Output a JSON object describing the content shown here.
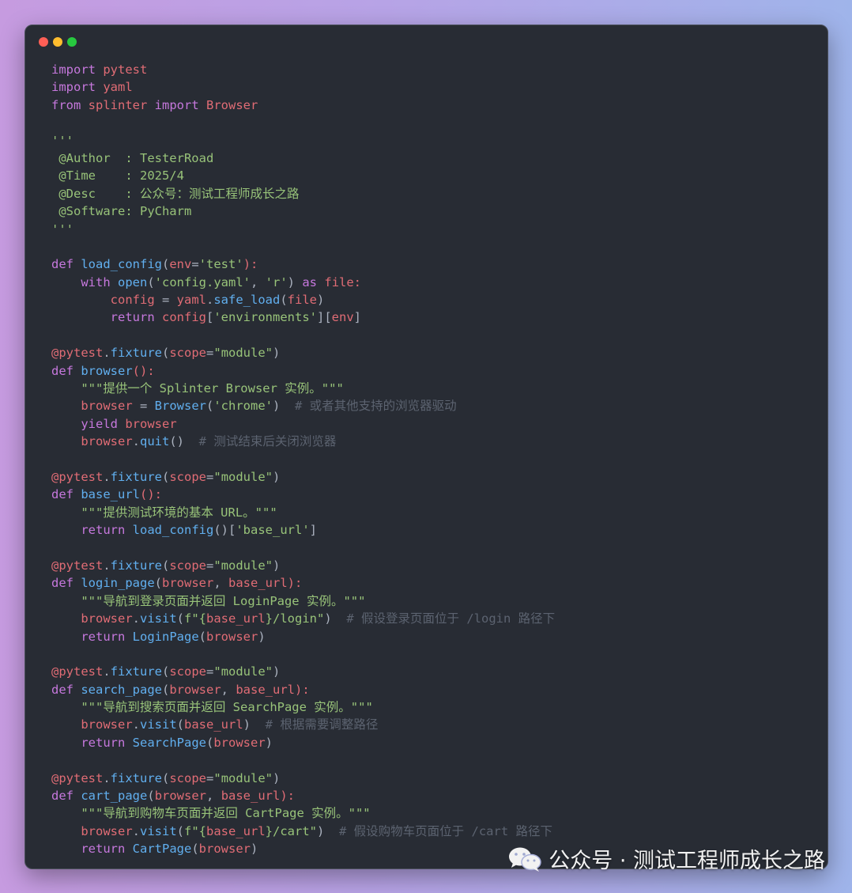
{
  "window": {
    "controls": [
      "close",
      "minimize",
      "zoom"
    ]
  },
  "code_lines": [
    [
      [
        "import",
        "kw"
      ],
      [
        " ",
        "pl"
      ],
      [
        "pytest",
        "mod"
      ]
    ],
    [
      [
        "import",
        "kw"
      ],
      [
        " ",
        "pl"
      ],
      [
        "yaml",
        "mod"
      ]
    ],
    [
      [
        "from",
        "kw"
      ],
      [
        " ",
        "pl"
      ],
      [
        "splinter",
        "mod"
      ],
      [
        " ",
        "pl"
      ],
      [
        "import",
        "kw"
      ],
      [
        " ",
        "pl"
      ],
      [
        "Browser",
        "mod"
      ]
    ],
    [],
    [
      [
        "'''",
        "str"
      ]
    ],
    [
      [
        " @Author  : TesterRoad",
        "str"
      ]
    ],
    [
      [
        " @Time    : 2025/4",
        "str"
      ]
    ],
    [
      [
        " @Desc    : 公众号：测试工程师成长之路",
        "str"
      ]
    ],
    [
      [
        " @Software: PyCharm",
        "str"
      ]
    ],
    [
      [
        "'''",
        "str"
      ]
    ],
    [],
    [
      [
        "def",
        "kw"
      ],
      [
        " ",
        "pl"
      ],
      [
        "load_config",
        "fn"
      ],
      [
        "(",
        "pl"
      ],
      [
        "env",
        "mod"
      ],
      [
        "=",
        "pl"
      ],
      [
        "'test'",
        "str"
      ],
      [
        "):",
        "mod"
      ]
    ],
    [
      [
        "    ",
        "pl"
      ],
      [
        "with",
        "kw"
      ],
      [
        " ",
        "pl"
      ],
      [
        "open",
        "fn"
      ],
      [
        "(",
        "pl"
      ],
      [
        "'config.yaml'",
        "str"
      ],
      [
        ", ",
        "pl"
      ],
      [
        "'r'",
        "str"
      ],
      [
        ") ",
        "pl"
      ],
      [
        "as",
        "kw"
      ],
      [
        " ",
        "pl"
      ],
      [
        "file:",
        "mod"
      ]
    ],
    [
      [
        "        ",
        "pl"
      ],
      [
        "config",
        "mod"
      ],
      [
        " = ",
        "pl"
      ],
      [
        "yaml",
        "mod"
      ],
      [
        ".",
        "pl"
      ],
      [
        "safe_load",
        "fn"
      ],
      [
        "(",
        "pl"
      ],
      [
        "file",
        "mod"
      ],
      [
        ")",
        "pl"
      ]
    ],
    [
      [
        "        ",
        "pl"
      ],
      [
        "return",
        "kw"
      ],
      [
        " ",
        "pl"
      ],
      [
        "config",
        "mod"
      ],
      [
        "[",
        "pl"
      ],
      [
        "'environments'",
        "str"
      ],
      [
        "][",
        "pl"
      ],
      [
        "env",
        "mod"
      ],
      [
        "]",
        "pl"
      ]
    ],
    [],
    [
      [
        "@pytest",
        "dec"
      ],
      [
        ".",
        "pl"
      ],
      [
        "fixture",
        "fn"
      ],
      [
        "(",
        "pl"
      ],
      [
        "scope",
        "mod"
      ],
      [
        "=",
        "pl"
      ],
      [
        "\"module\"",
        "str"
      ],
      [
        ")",
        "pl"
      ]
    ],
    [
      [
        "def",
        "kw"
      ],
      [
        " ",
        "pl"
      ],
      [
        "browser",
        "fn"
      ],
      [
        "():",
        "mod"
      ]
    ],
    [
      [
        "    ",
        "pl"
      ],
      [
        "\"\"\"提供一个 Splinter Browser 实例。\"\"\"",
        "str"
      ]
    ],
    [
      [
        "    ",
        "pl"
      ],
      [
        "browser",
        "mod"
      ],
      [
        " = ",
        "pl"
      ],
      [
        "Browser",
        "fn"
      ],
      [
        "(",
        "pl"
      ],
      [
        "'chrome'",
        "str"
      ],
      [
        ")  ",
        "pl"
      ],
      [
        "# 或者其他支持的浏览器驱动",
        "cmt"
      ]
    ],
    [
      [
        "    ",
        "pl"
      ],
      [
        "yield",
        "kw"
      ],
      [
        " ",
        "pl"
      ],
      [
        "browser",
        "mod"
      ]
    ],
    [
      [
        "    ",
        "pl"
      ],
      [
        "browser",
        "mod"
      ],
      [
        ".",
        "pl"
      ],
      [
        "quit",
        "fn"
      ],
      [
        "()  ",
        "pl"
      ],
      [
        "# 测试结束后关闭浏览器",
        "cmt"
      ]
    ],
    [],
    [
      [
        "@pytest",
        "dec"
      ],
      [
        ".",
        "pl"
      ],
      [
        "fixture",
        "fn"
      ],
      [
        "(",
        "pl"
      ],
      [
        "scope",
        "mod"
      ],
      [
        "=",
        "pl"
      ],
      [
        "\"module\"",
        "str"
      ],
      [
        ")",
        "pl"
      ]
    ],
    [
      [
        "def",
        "kw"
      ],
      [
        " ",
        "pl"
      ],
      [
        "base_url",
        "fn"
      ],
      [
        "():",
        "mod"
      ]
    ],
    [
      [
        "    ",
        "pl"
      ],
      [
        "\"\"\"提供测试环境的基本 URL。\"\"\"",
        "str"
      ]
    ],
    [
      [
        "    ",
        "pl"
      ],
      [
        "return",
        "kw"
      ],
      [
        " ",
        "pl"
      ],
      [
        "load_config",
        "fn"
      ],
      [
        "()[",
        "pl"
      ],
      [
        "'base_url'",
        "str"
      ],
      [
        "]",
        "pl"
      ]
    ],
    [],
    [
      [
        "@pytest",
        "dec"
      ],
      [
        ".",
        "pl"
      ],
      [
        "fixture",
        "fn"
      ],
      [
        "(",
        "pl"
      ],
      [
        "scope",
        "mod"
      ],
      [
        "=",
        "pl"
      ],
      [
        "\"module\"",
        "str"
      ],
      [
        ")",
        "pl"
      ]
    ],
    [
      [
        "def",
        "kw"
      ],
      [
        " ",
        "pl"
      ],
      [
        "login_page",
        "fn"
      ],
      [
        "(",
        "pl"
      ],
      [
        "browser",
        "mod"
      ],
      [
        ", ",
        "pl"
      ],
      [
        "base_url",
        "mod"
      ],
      [
        "):",
        "mod"
      ]
    ],
    [
      [
        "    ",
        "pl"
      ],
      [
        "\"\"\"导航到登录页面并返回 LoginPage 实例。\"\"\"",
        "str"
      ]
    ],
    [
      [
        "    ",
        "pl"
      ],
      [
        "browser",
        "mod"
      ],
      [
        ".",
        "pl"
      ],
      [
        "visit",
        "fn"
      ],
      [
        "(",
        "pl"
      ],
      [
        "f\"{",
        "str"
      ],
      [
        "base_url",
        "mod"
      ],
      [
        "}/login\"",
        "str"
      ],
      [
        ")  ",
        "pl"
      ],
      [
        "# 假设登录页面位于 /login 路径下",
        "cmt"
      ]
    ],
    [
      [
        "    ",
        "pl"
      ],
      [
        "return",
        "kw"
      ],
      [
        " ",
        "pl"
      ],
      [
        "LoginPage",
        "fn"
      ],
      [
        "(",
        "pl"
      ],
      [
        "browser",
        "mod"
      ],
      [
        ")",
        "pl"
      ]
    ],
    [],
    [
      [
        "@pytest",
        "dec"
      ],
      [
        ".",
        "pl"
      ],
      [
        "fixture",
        "fn"
      ],
      [
        "(",
        "pl"
      ],
      [
        "scope",
        "mod"
      ],
      [
        "=",
        "pl"
      ],
      [
        "\"module\"",
        "str"
      ],
      [
        ")",
        "pl"
      ]
    ],
    [
      [
        "def",
        "kw"
      ],
      [
        " ",
        "pl"
      ],
      [
        "search_page",
        "fn"
      ],
      [
        "(",
        "pl"
      ],
      [
        "browser",
        "mod"
      ],
      [
        ", ",
        "pl"
      ],
      [
        "base_url",
        "mod"
      ],
      [
        "):",
        "mod"
      ]
    ],
    [
      [
        "    ",
        "pl"
      ],
      [
        "\"\"\"导航到搜索页面并返回 SearchPage 实例。\"\"\"",
        "str"
      ]
    ],
    [
      [
        "    ",
        "pl"
      ],
      [
        "browser",
        "mod"
      ],
      [
        ".",
        "pl"
      ],
      [
        "visit",
        "fn"
      ],
      [
        "(",
        "pl"
      ],
      [
        "base_url",
        "mod"
      ],
      [
        ")  ",
        "pl"
      ],
      [
        "# 根据需要调整路径",
        "cmt"
      ]
    ],
    [
      [
        "    ",
        "pl"
      ],
      [
        "return",
        "kw"
      ],
      [
        " ",
        "pl"
      ],
      [
        "SearchPage",
        "fn"
      ],
      [
        "(",
        "pl"
      ],
      [
        "browser",
        "mod"
      ],
      [
        ")",
        "pl"
      ]
    ],
    [],
    [
      [
        "@pytest",
        "dec"
      ],
      [
        ".",
        "pl"
      ],
      [
        "fixture",
        "fn"
      ],
      [
        "(",
        "pl"
      ],
      [
        "scope",
        "mod"
      ],
      [
        "=",
        "pl"
      ],
      [
        "\"module\"",
        "str"
      ],
      [
        ")",
        "pl"
      ]
    ],
    [
      [
        "def",
        "kw"
      ],
      [
        " ",
        "pl"
      ],
      [
        "cart_page",
        "fn"
      ],
      [
        "(",
        "pl"
      ],
      [
        "browser",
        "mod"
      ],
      [
        ", ",
        "pl"
      ],
      [
        "base_url",
        "mod"
      ],
      [
        "):",
        "mod"
      ]
    ],
    [
      [
        "    ",
        "pl"
      ],
      [
        "\"\"\"导航到购物车页面并返回 CartPage 实例。\"\"\"",
        "str"
      ]
    ],
    [
      [
        "    ",
        "pl"
      ],
      [
        "browser",
        "mod"
      ],
      [
        ".",
        "pl"
      ],
      [
        "visit",
        "fn"
      ],
      [
        "(",
        "pl"
      ],
      [
        "f\"{",
        "str"
      ],
      [
        "base_url",
        "mod"
      ],
      [
        "}/cart\"",
        "str"
      ],
      [
        ")  ",
        "pl"
      ],
      [
        "# 假设购物车页面位于 /cart 路径下",
        "cmt"
      ]
    ],
    [
      [
        "    ",
        "pl"
      ],
      [
        "return",
        "kw"
      ],
      [
        " ",
        "pl"
      ],
      [
        "CartPage",
        "fn"
      ],
      [
        "(",
        "pl"
      ],
      [
        "browser",
        "mod"
      ],
      [
        ")",
        "pl"
      ]
    ]
  ],
  "watermark": {
    "icon": "wechat-icon",
    "text": "公众号 · 测试工程师成长之路"
  }
}
